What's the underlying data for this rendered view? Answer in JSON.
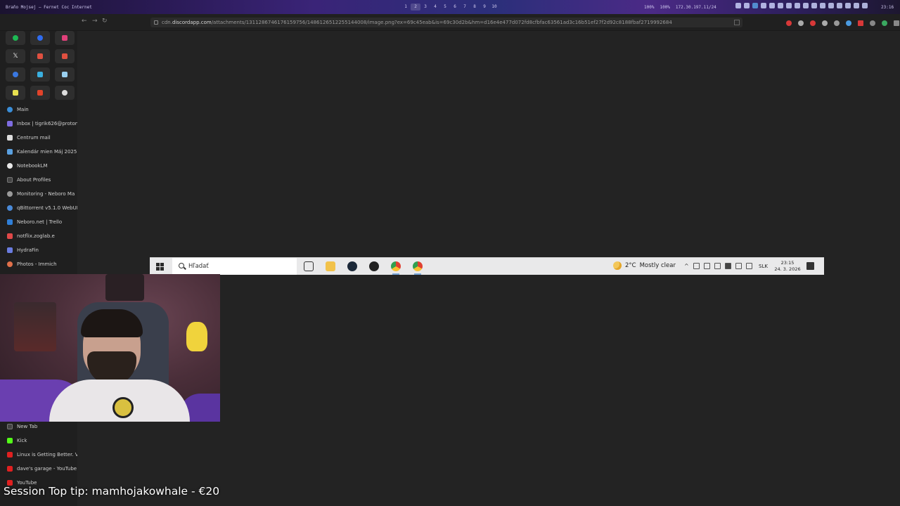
{
  "topbar": {
    "window_title": "Braňo Mojsej — Fernet Coc Internet",
    "workspaces": [
      "1",
      "2",
      "3",
      "4",
      "5",
      "6",
      "7",
      "8",
      "9",
      "10"
    ],
    "active_workspace": "2",
    "cpu": "100%",
    "ram": "100%",
    "ip": "172.30.197.11/24",
    "clock": "23:16"
  },
  "browser": {
    "url_prefix": "cdn.",
    "url_domain": "discordapp.com",
    "url_rest": "/attachments/1311286746176159756/1486126512255144008/image.png?ex=69c45eab&is=69c30d2b&hm=d16e4e477d072fd8cfbfac63561ad3c16b51ef27f2d92c8188fbaf2719992684",
    "back_icon": "arrow-left-icon",
    "forward_icon": "arrow-right-icon",
    "reload_icon": "reload-icon"
  },
  "sidebar": {
    "tabs": [
      {
        "label": "Main",
        "color": "#3a8ed8"
      },
      {
        "label": "Inbox | tigrik626@proton",
        "color": "#7e6ce0"
      },
      {
        "label": "Centrum mail",
        "color": "#dddddd"
      },
      {
        "label": "Kalendár mien Máj 2025",
        "color": "#5aa0e0"
      },
      {
        "label": "NotebookLM",
        "color": "#e8e8e8"
      },
      {
        "label": "About Profiles",
        "color": "#444444"
      },
      {
        "label": "Monitoring - Neboro Ma",
        "color": "#9a9a9a"
      },
      {
        "label": "qBittorrent v5.1.0 WebUI",
        "color": "#4a8ad8"
      },
      {
        "label": "Neboro.net | Trello",
        "color": "#2f7fd8"
      },
      {
        "label": "notflix.zoglab.e",
        "color": "#e04848"
      },
      {
        "label": "HydraFin",
        "color": "#6a7ce0"
      },
      {
        "label": "Photos - Immich",
        "color": "#e0704a"
      }
    ],
    "bottom_tabs": [
      {
        "label": "New Tab",
        "color": "#444444"
      },
      {
        "label": "Kick",
        "color": "#53fc18"
      },
      {
        "label": "Linux is Getting Better. V",
        "color": "#e02020"
      },
      {
        "label": "dave's garage - YouTube",
        "color": "#e02020"
      },
      {
        "label": "YouTube",
        "color": "#e02020"
      }
    ]
  },
  "taskbar": {
    "search_placeholder": "Hľadať",
    "temperature": "2°C",
    "weather": "Mostly clear",
    "language": "SLK",
    "time": "23:15",
    "date": "24. 3. 2026"
  },
  "overlay": {
    "tip_text": "Session Top tip: mamhojakowhale - €20"
  }
}
